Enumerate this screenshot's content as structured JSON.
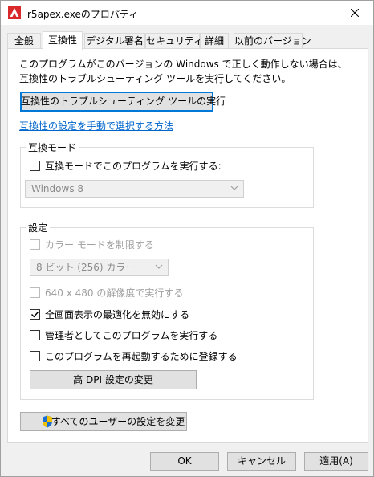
{
  "window": {
    "title": "r5apex.exeのプロパティ",
    "app_icon": "apex-legends-icon",
    "close_icon": "close-icon"
  },
  "tabs": [
    {
      "label": "全般",
      "active": false
    },
    {
      "label": "互換性",
      "active": true
    },
    {
      "label": "デジタル署名",
      "active": false
    },
    {
      "label": "セキュリティ",
      "active": false
    },
    {
      "label": "詳細",
      "active": false
    },
    {
      "label": "以前のバージョン",
      "active": false
    }
  ],
  "compat": {
    "description": "このプログラムがこのバージョンの Windows で正しく動作しない場合は、互換性のトラブルシューティング ツールを実行してください。",
    "troubleshoot_button": "互換性のトラブルシューティング ツールの実行",
    "manual_link": "互換性の設定を手動で選択する方法",
    "mode_group": {
      "label": "互換モード",
      "checkbox_label": "互換モードでこのプログラムを実行する:",
      "checked": false,
      "os_select_value": "Windows 8"
    },
    "settings_group": {
      "label": "設定",
      "reduced_color": {
        "label": "カラー モードを制限する",
        "checked": false,
        "disabled": true
      },
      "color_select_value": "8 ビット (256) カラー",
      "res_640": {
        "label": "640 x 480 の解像度で実行する",
        "checked": false,
        "disabled": true
      },
      "fullscreen_opt": {
        "label": "全画面表示の最適化を無効にする",
        "checked": true
      },
      "run_admin": {
        "label": "管理者としてこのプログラムを実行する",
        "checked": false
      },
      "register_restart": {
        "label": "このプログラムを再起動するために登録する",
        "checked": false
      },
      "dpi_button": "高 DPI 設定の変更"
    },
    "all_users_button": "すべてのユーザーの設定を変更",
    "shield_icon": "uac-shield-icon"
  },
  "footer": {
    "ok": "OK",
    "cancel": "キャンセル",
    "apply": "適用(A)"
  },
  "colors": {
    "accent": "#0078d7",
    "link": "#0066cc",
    "check": "#000000"
  }
}
